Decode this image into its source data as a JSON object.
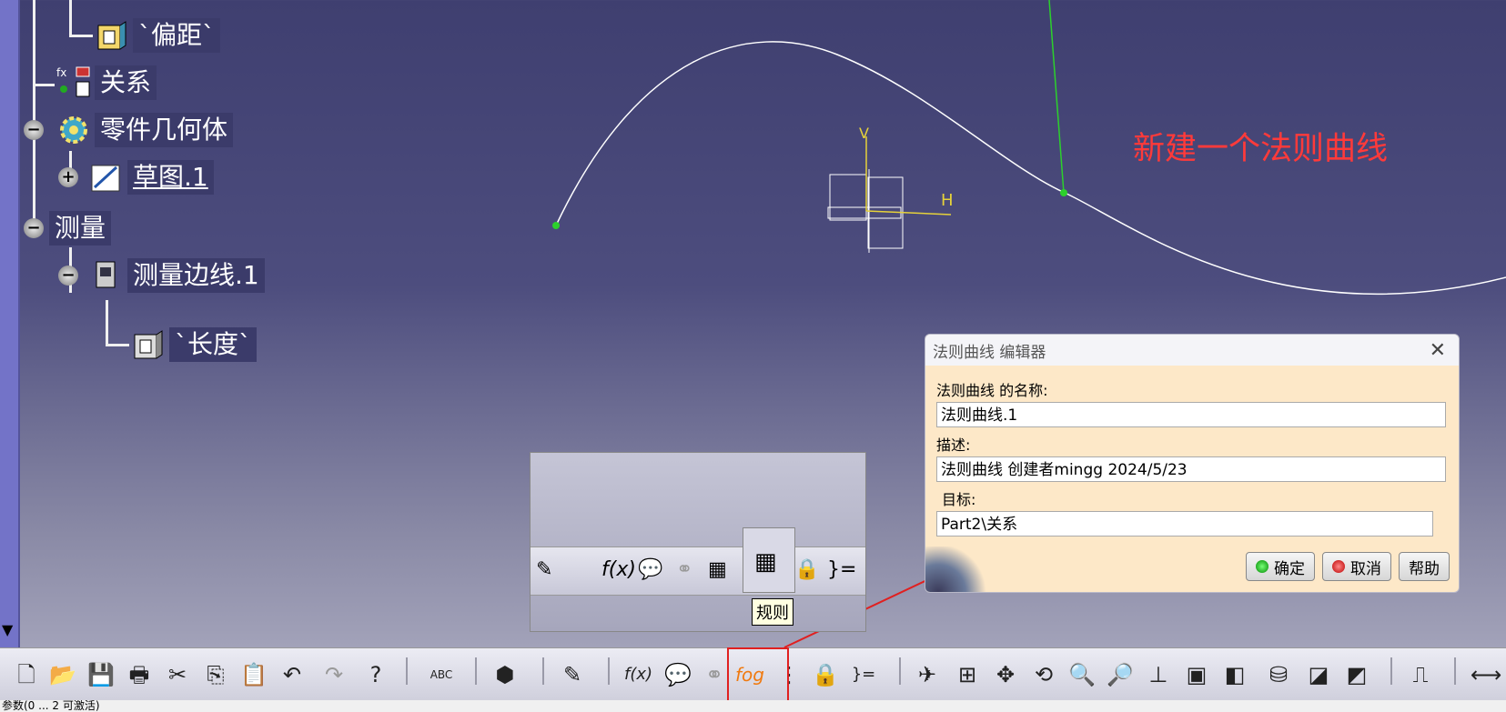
{
  "tree": {
    "item_offset": "`偏距`",
    "item_relations": "关系",
    "item_body": "零件几何体",
    "item_sketch": "草图.1",
    "item_measure": "测量",
    "item_measure_edge": "测量边线.1",
    "item_length": "`长度`"
  },
  "viewport": {
    "annotation": "新建一个法则曲线",
    "axis_v": "V",
    "axis_h": "H"
  },
  "dialog": {
    "title": "法则曲线 编辑器",
    "name_label": "法则曲线 的名称:",
    "name_value": "法则曲线.1",
    "desc_label": "描述:",
    "desc_value": "法则曲线 创建者mingg 2024/5/23",
    "target_label": "目标:",
    "target_value": "Part2\\关系",
    "ok_label": "确定",
    "cancel_label": "取消",
    "help_label": "帮助"
  },
  "tooltip": "规则",
  "toolbar": {
    "icons": [
      "new-icon",
      "open-icon",
      "save-icon",
      "print-icon",
      "cut-icon",
      "copy-icon",
      "paste-icon",
      "undo-icon",
      "redo-icon",
      "whats-this-icon",
      "spell-check-icon",
      "knowledge-advisor-icon",
      "sketch-analysis-icon",
      "formula-icon",
      "comment-icon",
      "link-icon",
      "law-icon",
      "parameters-icon",
      "lock-icon",
      "equations-icon",
      "fly-icon",
      "fit-all-icon",
      "pan-icon",
      "rotate-icon",
      "zoom-in-icon",
      "zoom-out-icon",
      "normal-view-icon",
      "multi-view-icon",
      "iso-view-icon",
      "shading-icon",
      "hide-show-icon",
      "swap-icon",
      "measure-icon",
      "measure-between-icon"
    ],
    "fog_label": "fog"
  },
  "statusbar": "参数(0 ... 2 可激活)"
}
